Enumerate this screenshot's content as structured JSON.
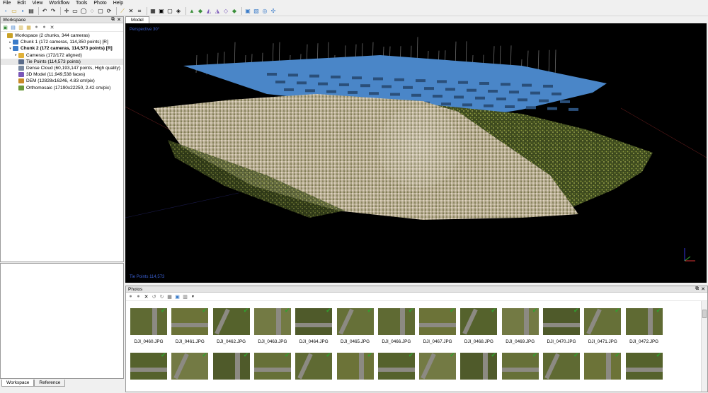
{
  "menu": [
    "File",
    "Edit",
    "View",
    "Workflow",
    "Tools",
    "Photo",
    "Help"
  ],
  "toolbar_icons": [
    "new-icon",
    "open-icon",
    "save-icon",
    "print-icon",
    "undo-icon",
    "redo-icon",
    "navigation-icon",
    "rectangle-selection-icon",
    "circle-selection-icon",
    "free-form-selection-icon",
    "resize-region-icon",
    "rotate-region-icon",
    "ruler-icon",
    "delete-icon",
    "crop-icon",
    "grid-view-icon",
    "zoom-in-icon",
    "zoom-out-icon",
    "reset-view-icon",
    "point-cloud-icon",
    "dense-cloud-icon",
    "shaded-model-icon",
    "solid-model-icon",
    "wireframe-model-icon",
    "textured-model-icon",
    "show-cameras-icon",
    "show-region-icon",
    "show-trackball-icon",
    "show-info-icon"
  ],
  "workspace": {
    "title": "Workspace",
    "tree": [
      {
        "label": "Workspace (2 chunks, 344 cameras)",
        "level": 0,
        "icon": "workspace-icon",
        "expander": "",
        "bold": false
      },
      {
        "label": "Chunk 1 (172 cameras, 114,350 points) [R]",
        "level": 1,
        "icon": "chunk-icon",
        "expander": "▸",
        "bold": false
      },
      {
        "label": "Chunk 2 (172 cameras, 114,573 points) [R]",
        "level": 1,
        "icon": "chunk-icon",
        "expander": "▾",
        "bold": true
      },
      {
        "label": "Cameras (172/172 aligned)",
        "level": 2,
        "icon": "folder-icon",
        "expander": "▸",
        "bold": false
      },
      {
        "label": "Tie Points (114,573 points)",
        "level": 2,
        "icon": "tie-points-icon",
        "expander": "",
        "bold": false,
        "selected": true
      },
      {
        "label": "Dense Cloud (60,193,147 points, High quality)",
        "level": 2,
        "icon": "dense-cloud-icon",
        "expander": "",
        "bold": false
      },
      {
        "label": "3D Model (11,949,538 faces)",
        "level": 2,
        "icon": "model-icon",
        "expander": "",
        "bold": false
      },
      {
        "label": "DEM (12828x16246, 4.83 cm/pix)",
        "level": 2,
        "icon": "dem-icon",
        "expander": "",
        "bold": false
      },
      {
        "label": "Orthomosaic (17190x22250, 2.42 cm/pix)",
        "level": 2,
        "icon": "orthomosaic-icon",
        "expander": "",
        "bold": false
      }
    ]
  },
  "bottom_tabs": [
    "Workspace",
    "Reference"
  ],
  "model": {
    "tab": "Model",
    "overlay_top": "Perspective 30°",
    "overlay_bottom": "Tie Points 114,573"
  },
  "photos": {
    "title": "Photos",
    "row1": [
      "DJI_0460.JPG",
      "DJI_0461.JPG",
      "DJI_0462.JPG",
      "DJI_0463.JPG",
      "DJI_0464.JPG",
      "DJI_0465.JPG",
      "DJI_0466.JPG",
      "DJI_0467.JPG",
      "DJI_0468.JPG",
      "DJI_0469.JPG",
      "DJI_0470.JPG",
      "DJI_0471.JPG",
      "DJI_0472.JPG"
    ],
    "row2_count": 13
  },
  "colors": {
    "camera_planes": "#4a86c8",
    "background_3d": "#000000",
    "check": "#2fa32f"
  }
}
